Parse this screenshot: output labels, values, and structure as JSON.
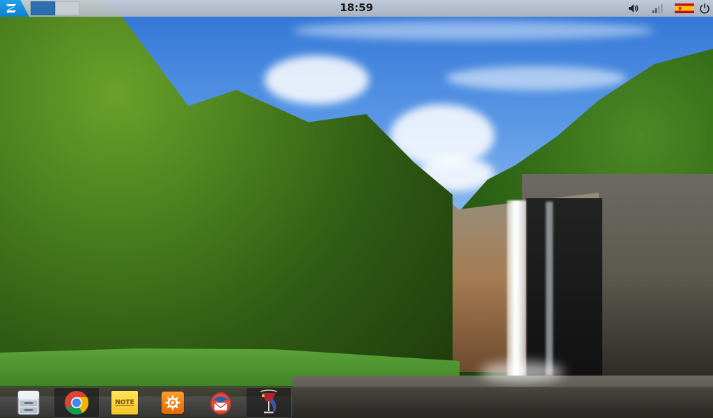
{
  "top_panel": {
    "clock": "18:59",
    "workspaces": [
      {
        "state": "active"
      },
      {
        "state": "inactive"
      }
    ],
    "tray": {
      "volume_icon": "speaker-icon",
      "network_icon": "signal-bars-icon",
      "keyboard_layout_icon": "spain-flag-icon",
      "power_icon": "power-icon"
    },
    "menu_icon": "zorin-logo-icon"
  },
  "dock": {
    "launchers": [
      {
        "name": "file-manager-icon",
        "running": false
      },
      {
        "name": "chrome-icon",
        "running": true
      },
      {
        "name": "notes-icon",
        "label": "NOTE",
        "running": false
      },
      {
        "name": "settings-gear-icon",
        "running": false
      },
      {
        "name": "mail-client-icon",
        "running": false
      },
      {
        "name": "wine-glass-app-icon",
        "running": true
      }
    ]
  },
  "colors": {
    "accent": "#1592df",
    "workspace_active": "#2b6fb0",
    "dock_bg": "#2f2d2a",
    "panel_bg": "#c4c9d1"
  }
}
